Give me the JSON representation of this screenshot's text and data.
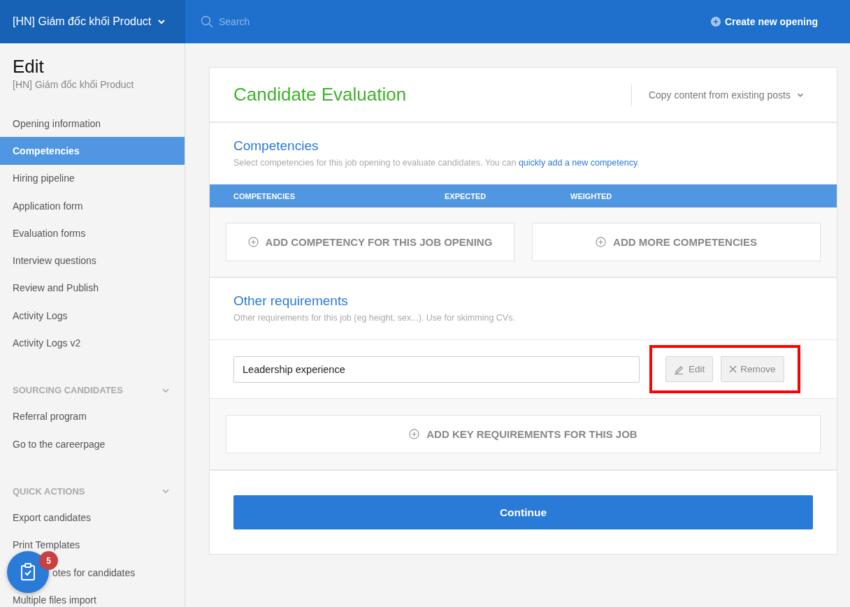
{
  "header": {
    "workspace": "[HN] Giám đốc khối Product",
    "search_placeholder": "Search",
    "create_button": "Create new opening"
  },
  "sidebar": {
    "title": "Edit",
    "subtitle": "[HN] Giám đốc khối Product",
    "items": [
      {
        "label": "Opening information",
        "selected": false
      },
      {
        "label": "Competencies",
        "selected": true
      },
      {
        "label": "Hiring pipeline",
        "selected": false
      },
      {
        "label": "Application form",
        "selected": false
      },
      {
        "label": "Evaluation forms",
        "selected": false
      },
      {
        "label": "Interview questions",
        "selected": false
      },
      {
        "label": "Review and Publish",
        "selected": false
      },
      {
        "label": "Activity Logs",
        "selected": false
      },
      {
        "label": "Activity Logs v2",
        "selected": false
      }
    ],
    "sections": [
      {
        "title": "SOURCING CANDIDATES",
        "expanded": true,
        "items": [
          {
            "label": "Referral program",
            "covered": false
          },
          {
            "label": "Go to the careerpage",
            "covered": false
          }
        ]
      },
      {
        "title": "QUICK ACTIONS",
        "expanded": true,
        "items": [
          {
            "label": "Export candidates",
            "covered": false
          },
          {
            "label": "Print Templates",
            "covered": false
          },
          {
            "label": "otes for candidates",
            "covered": true
          },
          {
            "label": "Multiple files import",
            "covered": false
          }
        ]
      }
    ]
  },
  "fab": {
    "badge": "5"
  },
  "card": {
    "title": "Candidate Evaluation",
    "copy_menu": "Copy content from existing posts",
    "competencies": {
      "title": "Competencies",
      "description": "Select competencies for this job opening to evaluate candidates. You can ",
      "link": "quickly add a new competency",
      "description_end": ".",
      "columns": [
        "COMPETENCIES",
        "EXPECTED",
        "WEIGHTED"
      ],
      "buttons": [
        "ADD COMPETENCY FOR THIS JOB OPENING",
        "ADD MORE COMPETENCIES"
      ]
    },
    "other": {
      "title": "Other requirements",
      "description": "Other requirements for this job (eg height, sex...). Use for skimming CVs.",
      "requirements": [
        {
          "value": "Leadership experience",
          "edit": "Edit",
          "remove": "Remove",
          "highlighted": true
        }
      ],
      "add_button": "ADD KEY REQUIREMENTS FOR THIS JOB"
    },
    "continue": "Continue"
  }
}
